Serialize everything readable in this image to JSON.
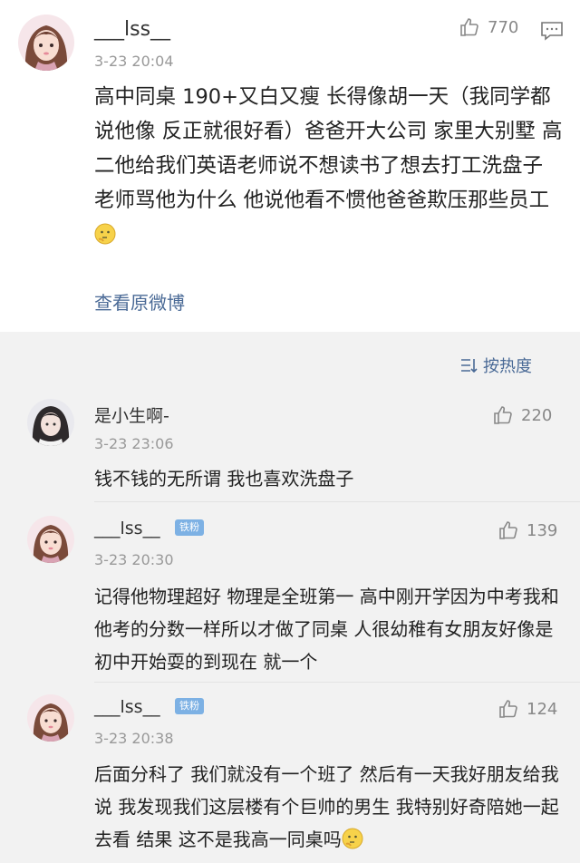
{
  "post": {
    "username": "___lss__",
    "time": "3-23 20:04",
    "likes": "770",
    "text": "高中同桌 190+又白又瘦 长得像胡一天（我同学都说他像 反正就很好看）爸爸开大公司 家里大别墅 高二他给我们英语老师说不想读书了想去打工洗盘子 老师骂他为什么 他说他看不惯他爸爸欺压那些员工",
    "view_original": "查看原微博"
  },
  "sort_label": "按热度",
  "comments": [
    {
      "username": "是小生啊-",
      "time": "3-23 23:06",
      "likes": "220",
      "text": "钱不钱的无所谓 我也喜欢洗盘子"
    },
    {
      "username": "___lss__",
      "badge": "铁粉",
      "time": "3-23 20:30",
      "likes": "139",
      "text": "记得他物理超好 物理是全班第一 高中刚开学因为中考我和他考的分数一样所以才做了同桌 人很幼稚有女朋友好像是初中开始耍的到现在 就一个"
    },
    {
      "username": "___lss__",
      "badge": "铁粉",
      "time": "3-23 20:38",
      "likes": "124",
      "text": "后面分科了 我们就没有一个班了 然后有一天我好朋友给我说 我发现我们这层楼有个巨帅的男生 我特别好奇陪她一起去看 结果 这不是我高一同桌吗"
    }
  ]
}
